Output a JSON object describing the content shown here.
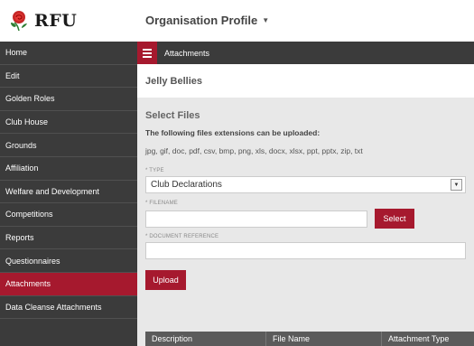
{
  "brand": {
    "logo_text": "RFU",
    "accent": "#a6192e"
  },
  "header": {
    "title": "Organisation Profile",
    "caret_icon": "caret-down-icon"
  },
  "sidebar": {
    "items": [
      {
        "label": "Home"
      },
      {
        "label": "Edit"
      },
      {
        "label": "Golden Roles"
      },
      {
        "label": "Club House"
      },
      {
        "label": "Grounds"
      },
      {
        "label": "Affiliation"
      },
      {
        "label": "Welfare and Development"
      },
      {
        "label": "Competitions"
      },
      {
        "label": "Reports"
      },
      {
        "label": "Questionnaires"
      },
      {
        "label": "Attachments",
        "active": true
      },
      {
        "label": "Data Cleanse Attachments"
      }
    ]
  },
  "breadcrumb": {
    "label": "Attachments"
  },
  "club": {
    "name": "Jelly Bellies"
  },
  "select_files": {
    "title": "Select Files",
    "extensions_label": "The following files extensions can be uploaded:",
    "extensions": "jpg, gif, doc, pdf, csv, bmp, png, xls, docx, xlsx, ppt, pptx, zip, txt"
  },
  "form": {
    "type_label": "* TYPE",
    "type_value": "Club Declarations",
    "filename_label": "* FILENAME",
    "filename_value": "",
    "select_button": "Select",
    "docref_label": "* DOCUMENT REFERENCE",
    "docref_value": "",
    "upload_button": "Upload"
  },
  "table": {
    "columns": [
      "Description",
      "File Name",
      "Attachment Type"
    ]
  }
}
